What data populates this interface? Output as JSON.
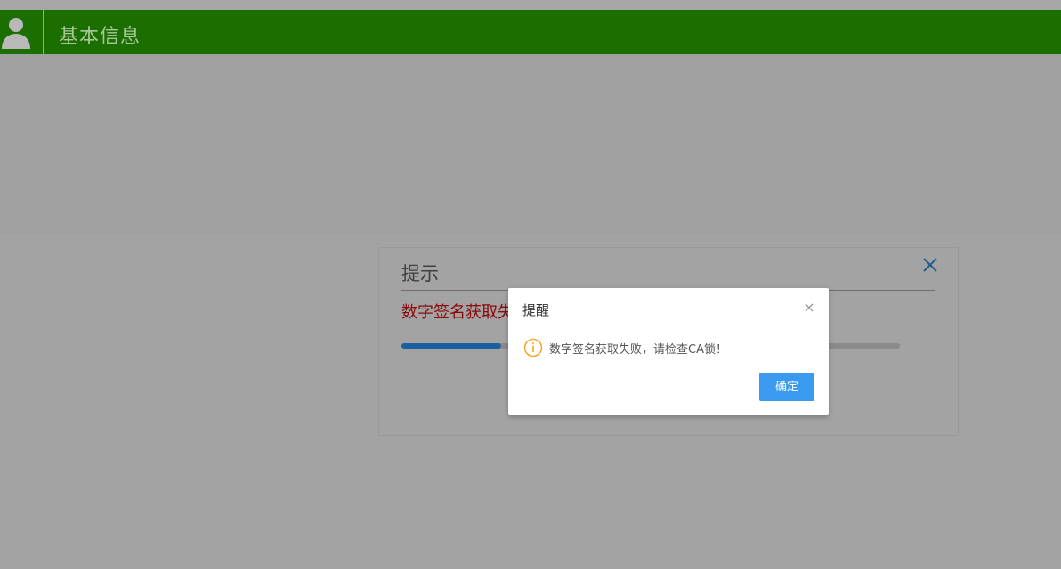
{
  "header": {
    "title": "基本信息",
    "avatar_icon": "user-silhouette-icon",
    "background_color": "#1b6f00"
  },
  "prompt_panel": {
    "title": "提示",
    "message": "数字签名获取失",
    "progress": 0.2,
    "close_icon": "close-icon"
  },
  "alert_dialog": {
    "title": "提醒",
    "message": "数字签名获取失败，请检查CA锁！",
    "warning_icon": "warning-circle-icon",
    "close_icon": "close-icon",
    "confirm_label": "确定",
    "confirm_color": "#3a9af0"
  }
}
